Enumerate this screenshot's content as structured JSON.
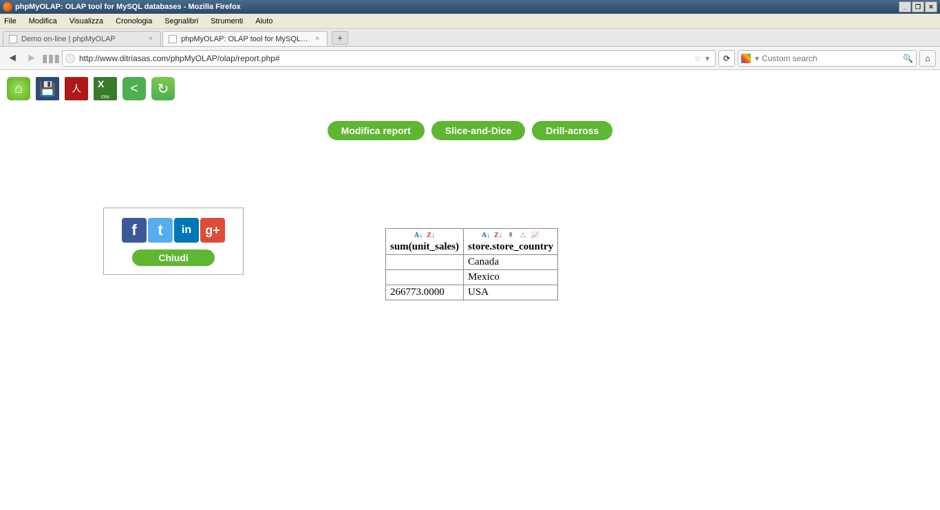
{
  "window": {
    "title": "phpMyOLAP: OLAP tool for MySQL databases - Mozilla Firefox"
  },
  "menu": {
    "items": [
      "File",
      "Modifica",
      "Visualizza",
      "Cronologia",
      "Segnalibri",
      "Strumenti",
      "Aiuto"
    ]
  },
  "tabs": {
    "items": [
      {
        "label": "Demo on-line | phpMyOLAP",
        "active": false
      },
      {
        "label": "phpMyOLAP: OLAP tool for MySQL datab...",
        "active": true
      }
    ]
  },
  "nav": {
    "url": "http://www.ditriasas.com/phpMyOLAP/olap/report.php#",
    "search_placeholder": "Custom search"
  },
  "app_toolbar": {
    "icons": [
      "home",
      "save",
      "pdf",
      "csv",
      "share",
      "refresh"
    ]
  },
  "action_buttons": {
    "modify": "Modifica report",
    "slice": "Slice-and-Dice",
    "drill": "Drill-across"
  },
  "social_box": {
    "buttons": [
      "facebook",
      "twitter",
      "linkedin",
      "googleplus"
    ],
    "close_label": "Chiudi"
  },
  "olap": {
    "measure_header": "sum(unit_sales)",
    "dimension_header": "store.store_country",
    "rows": [
      {
        "value": "",
        "country": "Canada"
      },
      {
        "value": "",
        "country": "Mexico"
      },
      {
        "value": "266773.0000",
        "country": "USA"
      }
    ]
  }
}
